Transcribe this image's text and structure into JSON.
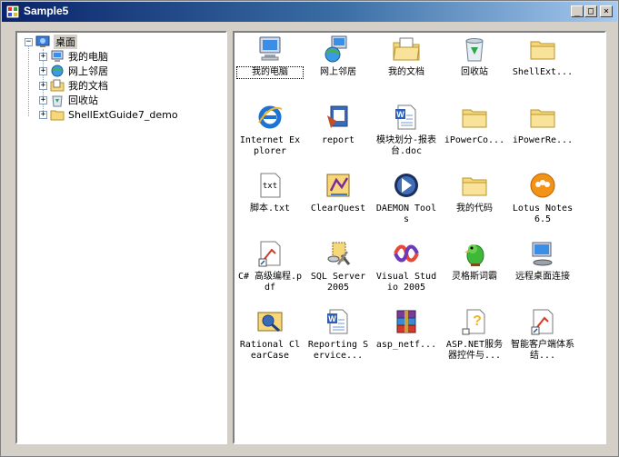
{
  "window": {
    "title": "Sample5"
  },
  "titlebar_buttons": {
    "minimize": "_",
    "maximize": "□",
    "close": "×"
  },
  "tree": {
    "root": {
      "label": "桌面",
      "expander": "−",
      "icon": "desktop-icon"
    },
    "children": [
      {
        "label": "我的电脑",
        "expander": "+",
        "icon": "my-computer-icon"
      },
      {
        "label": "网上邻居",
        "expander": "+",
        "icon": "network-icon"
      },
      {
        "label": "我的文档",
        "expander": "+",
        "icon": "my-documents-icon"
      },
      {
        "label": "回收站",
        "expander": "+",
        "icon": "recycle-bin-icon"
      },
      {
        "label": "ShellExtGuide7_demo",
        "expander": "+",
        "icon": "folder-icon"
      }
    ]
  },
  "list": {
    "items": [
      {
        "label": "我的电脑",
        "icon": "my-computer-icon"
      },
      {
        "label": "网上邻居",
        "icon": "network-icon"
      },
      {
        "label": "我的文档",
        "icon": "my-documents-icon"
      },
      {
        "label": "回收站",
        "icon": "recycle-bin-icon"
      },
      {
        "label": "ShellExt...",
        "icon": "folder-icon"
      },
      {
        "label": "Internet Explorer",
        "icon": "internet-explorer-icon"
      },
      {
        "label": "report",
        "icon": "report-icon"
      },
      {
        "label": "模块划分-报表台.doc",
        "icon": "word-document-icon"
      },
      {
        "label": "iPowerCo...",
        "icon": "folder-icon"
      },
      {
        "label": "iPowerRe...",
        "icon": "folder-icon"
      },
      {
        "label": "脚本.txt",
        "icon": "text-file-icon"
      },
      {
        "label": "ClearQuest",
        "icon": "clearquest-icon"
      },
      {
        "label": "DAEMON Tools",
        "icon": "daemon-tools-icon"
      },
      {
        "label": "我的代码",
        "icon": "folder-icon"
      },
      {
        "label": "Lotus Notes 6.5",
        "icon": "lotus-notes-icon"
      },
      {
        "label": "C# 高级编程.pdf",
        "icon": "pdf-shortcut-icon"
      },
      {
        "label": "SQL Server 2005",
        "icon": "sql-server-icon"
      },
      {
        "label": "Visual Studio 2005",
        "icon": "visual-studio-icon"
      },
      {
        "label": "灵格斯词霸",
        "icon": "lingoes-parrot-icon"
      },
      {
        "label": "远程桌面连接",
        "icon": "remote-desktop-icon"
      },
      {
        "label": "Rational ClearCase",
        "icon": "clearcase-icon"
      },
      {
        "label": "Reporting Service...",
        "icon": "word-document-icon"
      },
      {
        "label": "asp_netf...",
        "icon": "winrar-archive-icon"
      },
      {
        "label": "ASP.NET服务器控件与...",
        "icon": "help-file-icon"
      },
      {
        "label": "智能客户端体系结...",
        "icon": "pdf-shortcut-icon"
      }
    ]
  }
}
